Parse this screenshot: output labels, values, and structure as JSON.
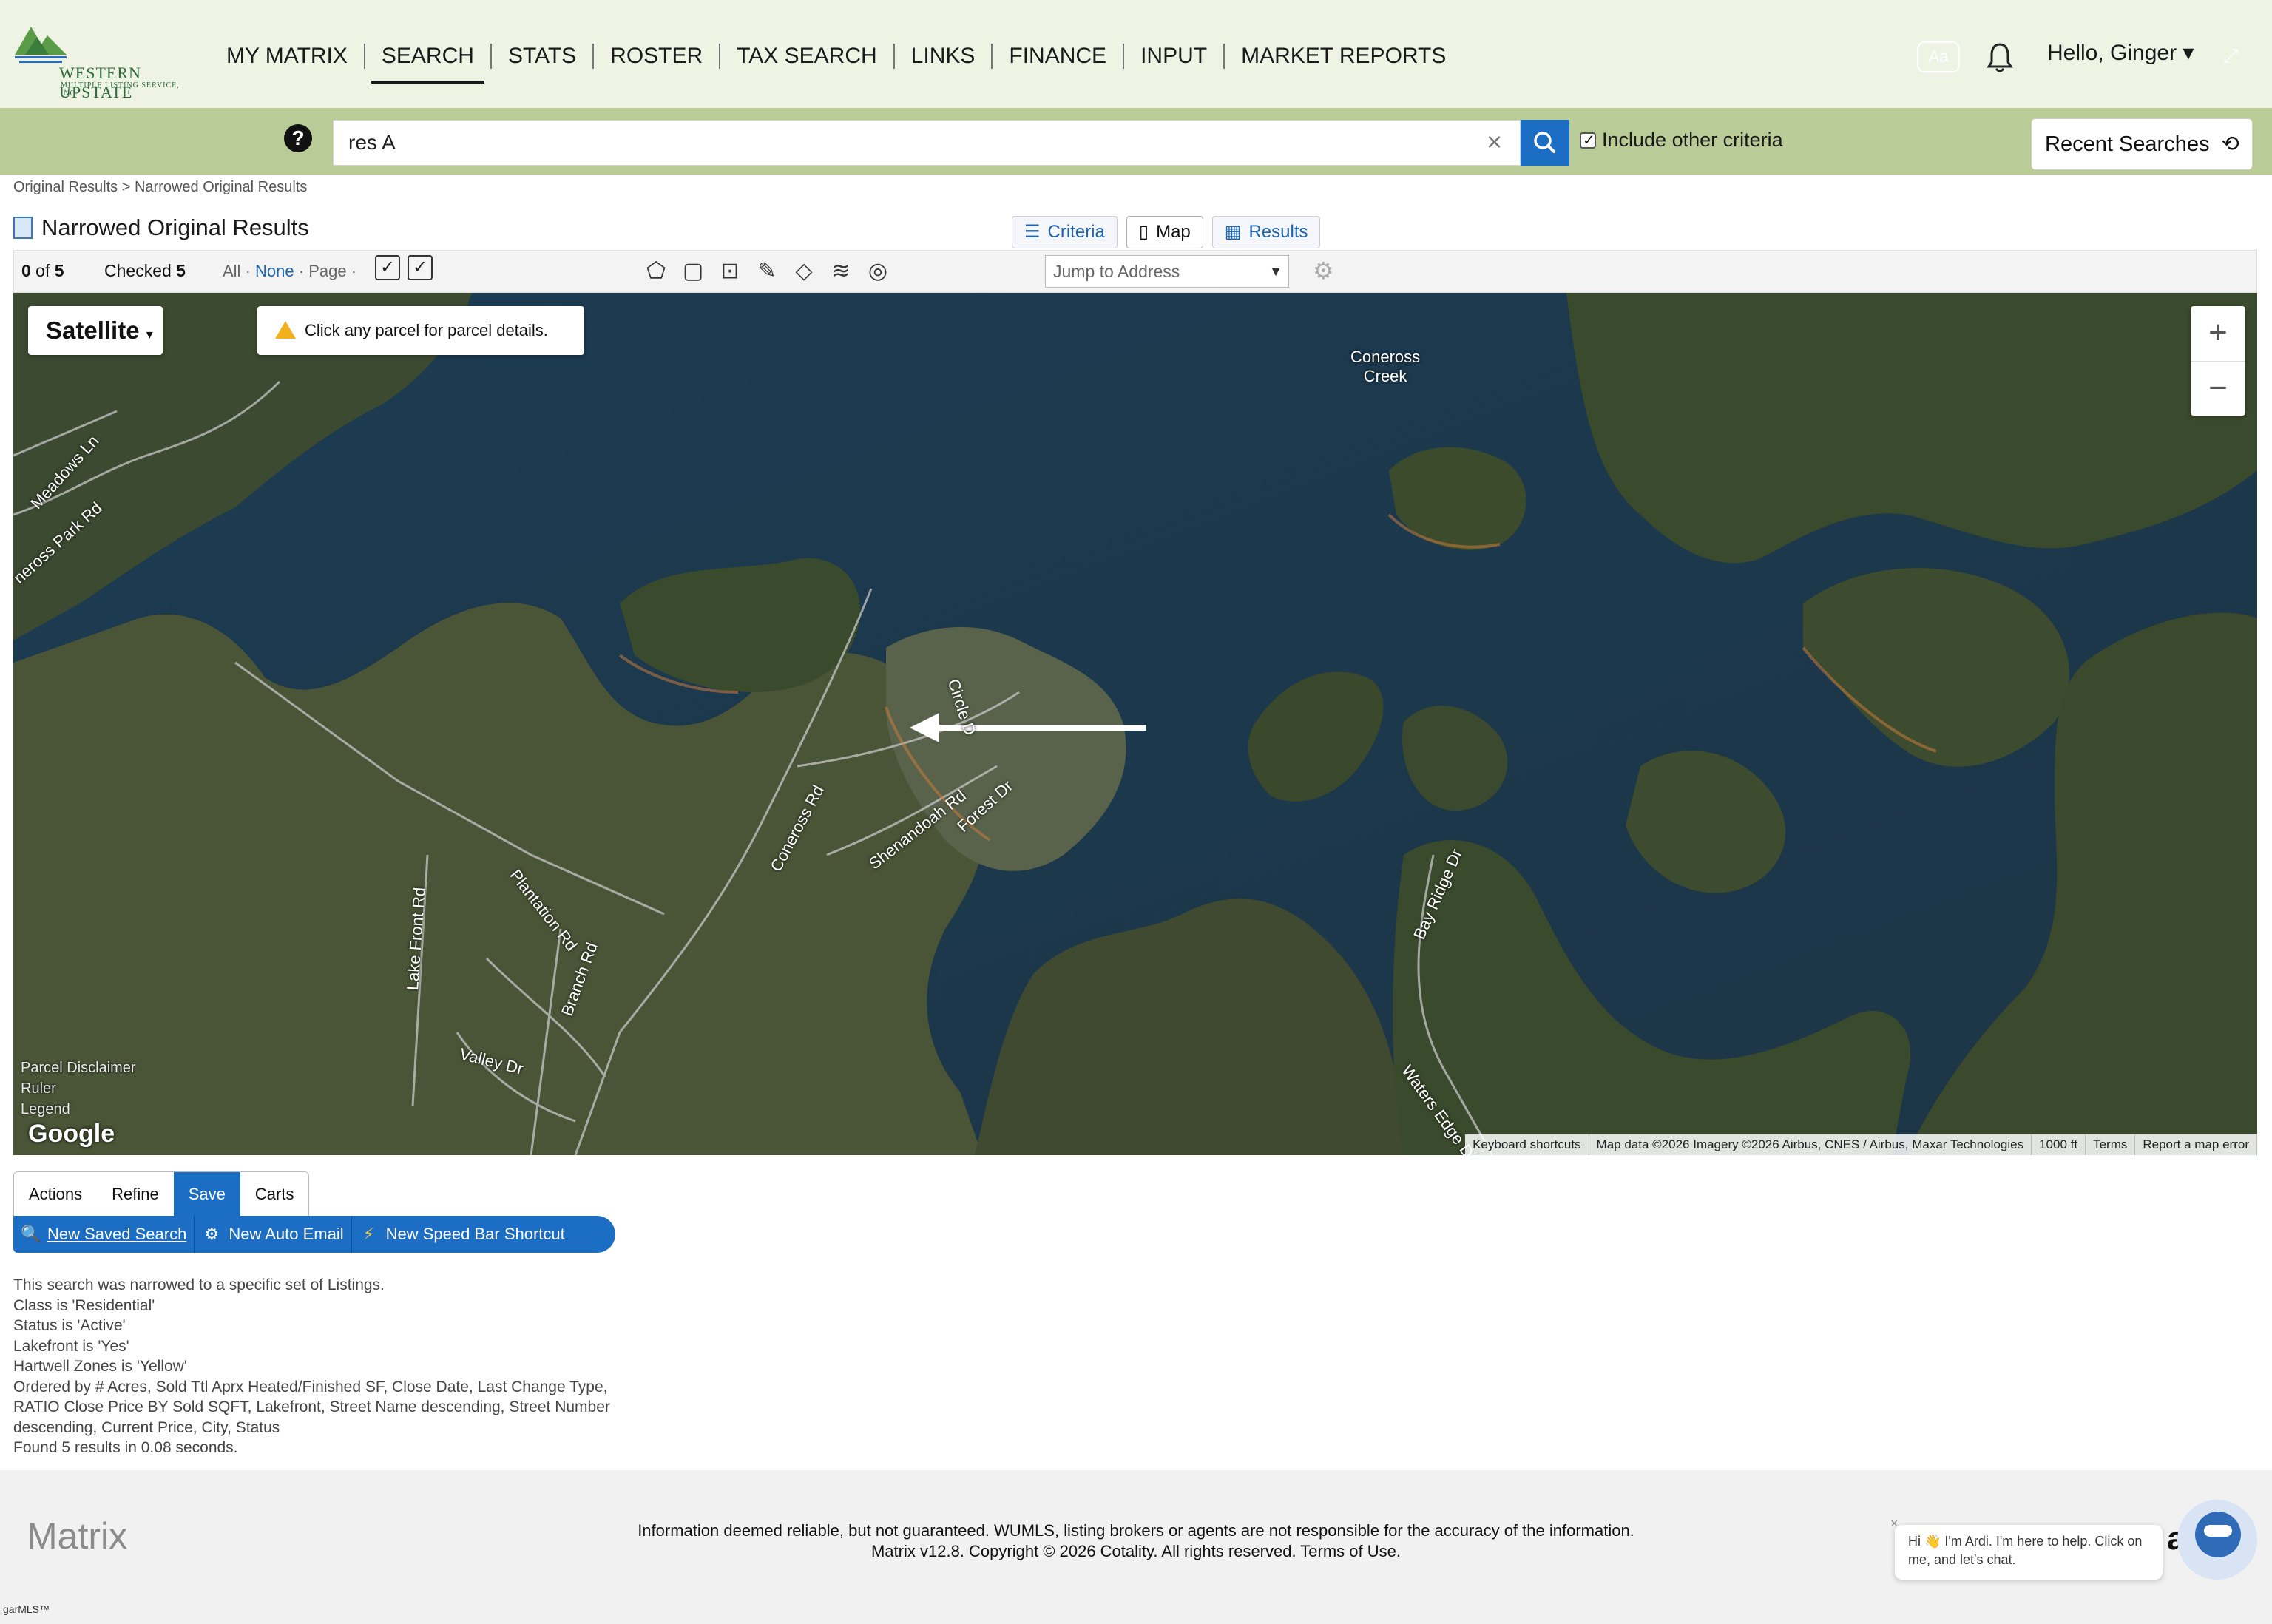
{
  "header": {
    "logo": {
      "line1": "WESTERN UPSTATE",
      "line2": "MULTIPLE LISTING SERVICE, INC."
    },
    "nav": [
      "MY MATRIX",
      "SEARCH",
      "STATS",
      "ROSTER",
      "TAX SEARCH",
      "LINKS",
      "FINANCE",
      "INPUT",
      "MARKET REPORTS"
    ],
    "active_nav": "SEARCH",
    "aa_label": "Aa",
    "greeting": "Hello, Ginger ▾"
  },
  "search": {
    "value": "res A",
    "include_other_label": "Include other criteria",
    "include_other_checked": true,
    "recent_label": "Recent Searches"
  },
  "breadcrumb": "Original Results > Narrowed Original Results",
  "page_title": "Narrowed Original Results",
  "view_tabs": [
    {
      "label": "Criteria",
      "icon": "sliders-icon"
    },
    {
      "label": "Map",
      "icon": "map-icon"
    },
    {
      "label": "Results",
      "icon": "grid-icon"
    }
  ],
  "active_view_tab": "Map",
  "toolbar": {
    "count_text": "0",
    "of_text": " of ",
    "total": "5",
    "checked_label": "Checked",
    "checked_count": "5",
    "all_label": "All",
    "none_label": "None",
    "page_label": "Page",
    "sep": "·",
    "jump_placeholder": "Jump to Address",
    "draw_tools": [
      "polygon-tool-icon",
      "rectangle-tool-icon",
      "radius-tool-icon",
      "pencil-tool-icon",
      "eraser-tool-icon",
      "layers-icon",
      "locate-icon"
    ]
  },
  "map": {
    "map_type": "Satellite",
    "hint": "Click any parcel for parcel details.",
    "labels": {
      "lake": "Coneross\nCreek",
      "meadows": "Meadows Ln",
      "coneross_park": "neross Park Rd",
      "circle": "Circle D",
      "coneross_rd": "Coneross Rd",
      "shenandoah": "Shenandoah Rd",
      "forest": "Forest Dr",
      "plantation": "Plantation Rd",
      "lake_front": "Lake Front Rd",
      "branch": "Branch Rd",
      "valley": "Valley Dr",
      "bay_ridge": "Bay Ridge Dr",
      "waters_edge": "Waters Edge Dr"
    },
    "left_links": [
      "Parcel Disclaimer",
      "Ruler",
      "Legend"
    ],
    "google": "Google",
    "attribution": [
      "Keyboard shortcuts",
      "Map data ©2026 Imagery ©2026 Airbus, CNES / Airbus, Maxar Technologies",
      "1000 ft",
      "Terms",
      "Report a map error"
    ]
  },
  "actions": {
    "tabs": [
      "Actions",
      "Refine",
      "Save",
      "Carts"
    ],
    "active_tab": "Save",
    "save_items": [
      {
        "label": "New Saved Search",
        "icon": "saved-search-icon"
      },
      {
        "label": "New Auto Email",
        "icon": "auto-email-icon"
      },
      {
        "label": "New Speed Bar Shortcut",
        "icon": "lightning-icon"
      }
    ]
  },
  "criteria_lines": [
    "This search was narrowed to a specific set of Listings.",
    "Class is 'Residential'",
    "Status is 'Active'",
    "Lakefront is 'Yes'",
    "Hartwell Zones is 'Yellow'",
    "Ordered by # Acres, Sold Ttl Aprx Heated/Finished SF, Close Date, Last Change Type,",
    "RATIO Close Price BY Sold SQFT, Lakefront, Street Name descending, Street Number",
    "descending, Current Price, City, Status",
    "Found 5 results in 0.08 seconds."
  ],
  "footer": {
    "matrix": "Matrix",
    "line1": "Information deemed reliable, but not guaranteed. WUMLS, listing brokers or agents are not responsible for the accuracy of the information.",
    "line2": "Matrix v12.8. Copyright © 2026 Cotality. All rights reserved. Terms of Use.",
    "chat": "Hi 👋 I'm Ardi. I'm here to help. Click on me, and let's chat.",
    "chat_close": "×",
    "brand_fragment": "al",
    "corner": "garMLS™"
  },
  "colors": {
    "header_bg": "#eef3e4",
    "search_bar_bg": "#b9cb97",
    "accent_blue": "#1c6ec4",
    "water": "#1f3a4e"
  }
}
